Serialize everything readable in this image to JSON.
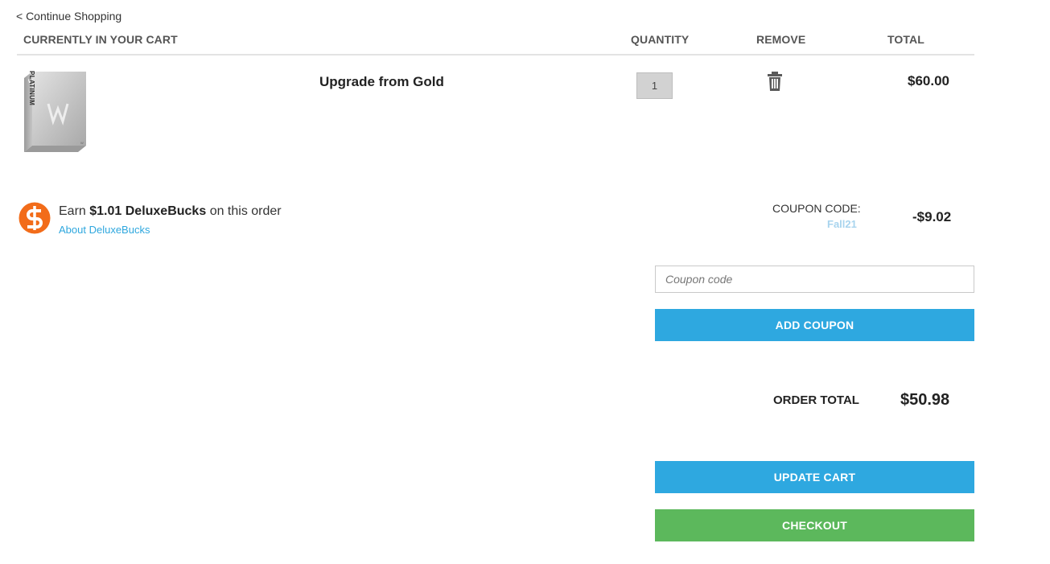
{
  "nav": {
    "continue_label": "< Continue Shopping"
  },
  "cart_header": {
    "item_col": "CURRENTLY IN YOUR CART",
    "quantity_col": "QUANTITY",
    "remove_col": "REMOVE",
    "total_col": "TOTAL"
  },
  "items": [
    {
      "name": "Upgrade from Gold",
      "box_label": "PLATINUM",
      "quantity": "1",
      "total": "$60.00",
      "remove_icon": "trash-icon"
    }
  ],
  "deluxebucks": {
    "earn_prefix": "Earn",
    "earn_amount": "$1.01 DeluxeBucks",
    "earn_suffix": "on this order",
    "about_link": "About DeluxeBucks",
    "icon": "dollar-coin-icon",
    "accent": "#f26c1a"
  },
  "coupon": {
    "label": "COUPON CODE:",
    "applied_code": "Fall21",
    "discount": "-$9.02",
    "input_placeholder": "Coupon code",
    "input_value": "",
    "add_button": "ADD COUPON"
  },
  "order": {
    "total_label": "ORDER TOTAL",
    "total_value": "$50.98"
  },
  "actions": {
    "update_cart": "UPDATE CART",
    "checkout": "CHECKOUT"
  },
  "colors": {
    "primary_button": "#2ea8e0",
    "checkout_button": "#5cb85c",
    "link": "#2ea7de"
  }
}
